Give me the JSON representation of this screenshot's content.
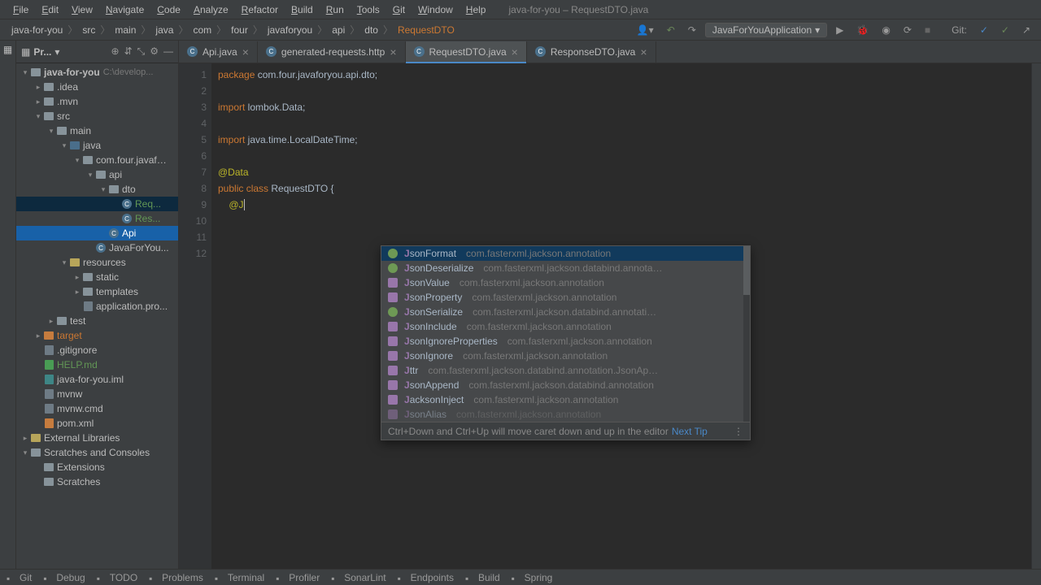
{
  "window_title": "java-for-you – RequestDTO.java",
  "menu": [
    "File",
    "Edit",
    "View",
    "Navigate",
    "Code",
    "Analyze",
    "Refactor",
    "Build",
    "Run",
    "Tools",
    "Git",
    "Window",
    "Help"
  ],
  "breadcrumbs": [
    "java-for-you",
    "src",
    "main",
    "java",
    "com",
    "four",
    "javaforyou",
    "api",
    "dto",
    "RequestDTO"
  ],
  "run_config": "JavaForYouApplication",
  "vcs_label": "Git:",
  "project": {
    "label": "Pr...",
    "root": "java-for-you",
    "root_suffix": "C:\\develop...",
    "items": [
      {
        "l": ".idea",
        "d": 1,
        "t": "folder"
      },
      {
        "l": ".mvn",
        "d": 1,
        "t": "folder"
      },
      {
        "l": "src",
        "d": 1,
        "t": "folder",
        "o": 1
      },
      {
        "l": "main",
        "d": 2,
        "t": "folder",
        "o": 1
      },
      {
        "l": "java",
        "d": 3,
        "t": "folder-blue",
        "o": 1
      },
      {
        "l": "com.four.javaf…",
        "d": 4,
        "t": "folder",
        "o": 1
      },
      {
        "l": "api",
        "d": 5,
        "t": "folder",
        "o": 1
      },
      {
        "l": "dto",
        "d": 6,
        "t": "folder",
        "o": 1
      },
      {
        "l": "Req...",
        "d": 7,
        "t": "class",
        "g": 1,
        "sel": 2
      },
      {
        "l": "Res...",
        "d": 7,
        "t": "class",
        "g": 1
      },
      {
        "l": "Api",
        "d": 6,
        "t": "class",
        "sel": 1
      },
      {
        "l": "JavaForYou...",
        "d": 5,
        "t": "class"
      },
      {
        "l": "resources",
        "d": 3,
        "t": "folder-yellow",
        "o": 1
      },
      {
        "l": "static",
        "d": 4,
        "t": "folder"
      },
      {
        "l": "templates",
        "d": 4,
        "t": "folder"
      },
      {
        "l": "application.pro...",
        "d": 4,
        "t": "file"
      },
      {
        "l": "test",
        "d": 2,
        "t": "folder"
      },
      {
        "l": "target",
        "d": 1,
        "t": "folder-orange",
        "or": 1
      },
      {
        "l": ".gitignore",
        "d": 1,
        "t": "file"
      },
      {
        "l": "HELP.md",
        "d": 1,
        "t": "file-green",
        "g": 1
      },
      {
        "l": "java-for-you.iml",
        "d": 1,
        "t": "file-teal"
      },
      {
        "l": "mvnw",
        "d": 1,
        "t": "file"
      },
      {
        "l": "mvnw.cmd",
        "d": 1,
        "t": "file"
      },
      {
        "l": "pom.xml",
        "d": 1,
        "t": "file-orange"
      }
    ],
    "external": "External Libraries",
    "scratches_root": "Scratches and Consoles",
    "scratches": [
      "Extensions",
      "Scratches"
    ]
  },
  "tabs": [
    {
      "label": "Api.java",
      "icon": "class"
    },
    {
      "label": "generated-requests.http",
      "icon": "file"
    },
    {
      "label": "RequestDTO.java",
      "icon": "class",
      "active": true
    },
    {
      "label": "ResponseDTO.java",
      "icon": "class"
    }
  ],
  "code": {
    "lines": [
      1,
      2,
      3,
      4,
      5,
      6,
      7,
      8,
      9,
      10,
      11,
      12
    ],
    "l1_kw": "package",
    "l1_rest": " com.four.javaforyou.api.dto;",
    "l3_kw": "import",
    "l3_rest": " lombok.Data;",
    "l5_kw": "import",
    "l5_rest": " java.time.LocalDateTime;",
    "l7_ann": "@Data",
    "l8_kw1": "public ",
    "l8_kw2": "class ",
    "l8_cls": "RequestDTO",
    "l8_rest": " {",
    "l9_indent": "    ",
    "l9_ann": "@J"
  },
  "completion": {
    "items": [
      {
        "n": "JsonFormat",
        "p": "com.fasterxml.jackson.annotation",
        "i": "a"
      },
      {
        "n": "JsonDeserialize",
        "p": "com.fasterxml.jackson.databind.annota…",
        "i": "a"
      },
      {
        "n": "JsonValue",
        "p": "com.fasterxml.jackson.annotation",
        "i": "b"
      },
      {
        "n": "JsonProperty",
        "p": "com.fasterxml.jackson.annotation",
        "i": "b"
      },
      {
        "n": "JsonSerialize",
        "p": "com.fasterxml.jackson.databind.annotati…",
        "i": "a"
      },
      {
        "n": "JsonInclude",
        "p": "com.fasterxml.jackson.annotation",
        "i": "b"
      },
      {
        "n": "JsonIgnoreProperties",
        "p": "com.fasterxml.jackson.annotation",
        "i": "b"
      },
      {
        "n": "JsonIgnore",
        "p": "com.fasterxml.jackson.annotation",
        "i": "b"
      },
      {
        "n": "Attr",
        "p": "com.fasterxml.jackson.databind.annotation.JsonAp…",
        "i": "b"
      },
      {
        "n": "JsonAppend",
        "p": "com.fasterxml.jackson.databind.annotation",
        "i": "b"
      },
      {
        "n": "JacksonInject",
        "p": "com.fasterxml.jackson.annotation",
        "i": "b"
      }
    ],
    "partial": {
      "n": "JsonAlias",
      "p": "com.fasterxml.jackson.annotation"
    },
    "hint": "Ctrl+Down and Ctrl+Up will move caret down and up in the editor",
    "tip": "Next Tip"
  },
  "statusbar": [
    "Git",
    "Debug",
    "TODO",
    "Problems",
    "Terminal",
    "Profiler",
    "SonarLint",
    "Endpoints",
    "Build",
    "Spring"
  ]
}
